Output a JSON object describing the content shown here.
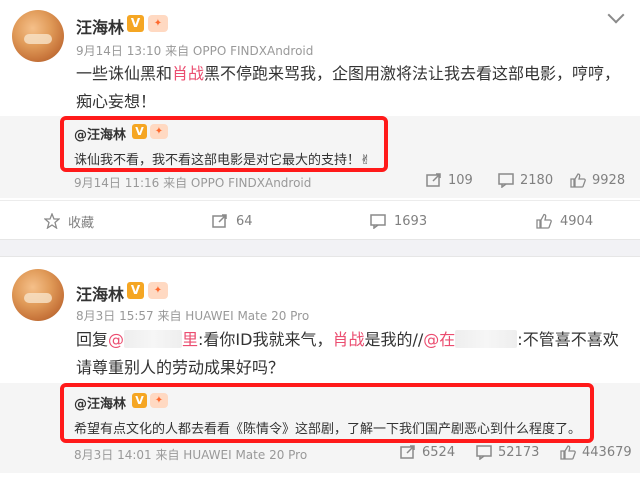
{
  "colors": {
    "highlight": "#eb4d70",
    "red_box": "#ff1a1a",
    "verified": "#f5a623"
  },
  "post1": {
    "username": "汪海林",
    "verified_badge": "V",
    "meta": "9月14日 13:10 来自 OPPO FINDXAndroid",
    "content_1": "一些诛仙黑和",
    "content_highlight": "肖战",
    "content_2": "黑不停跑来骂我，企图用激将法让我去看这部电影，哼哼，痴心妄想！",
    "quote": {
      "user": "@汪海林",
      "text": "诛仙我不看，我不看这部电影是对它最大的支持！✌",
      "meta": "9月14日 11:16 来自 OPPO FINDXAndroid",
      "reposts": "109",
      "comments": "2180",
      "likes": "9928"
    },
    "actions": {
      "favorite": "收藏",
      "reposts": "64",
      "comments": "1693",
      "likes": "4904"
    }
  },
  "post2": {
    "username": "汪海林",
    "verified_badge": "V",
    "meta": "8月3日 15:57 来自 HUAWEI Mate 20 Pro",
    "reply_prefix": "回复",
    "mention1_start": "@",
    "mention1_end": "里",
    "text_1": ":看你ID我就来气，",
    "highlight": "肖战",
    "text_2": "是我的//",
    "mention2_start": "@在",
    "text_3": ":不管喜不喜欢请尊重别人的劳动成果好吗？",
    "quote": {
      "user": "@汪海林",
      "text": "希望有点文化的人都去看看《陈情令》这部剧，了解一下我们国产剧恶心到什么程度了。",
      "meta": "8月3日 14:01 来自 HUAWEI Mate 20 Pro",
      "reposts": "6524",
      "comments": "52173",
      "likes": "443679"
    }
  }
}
